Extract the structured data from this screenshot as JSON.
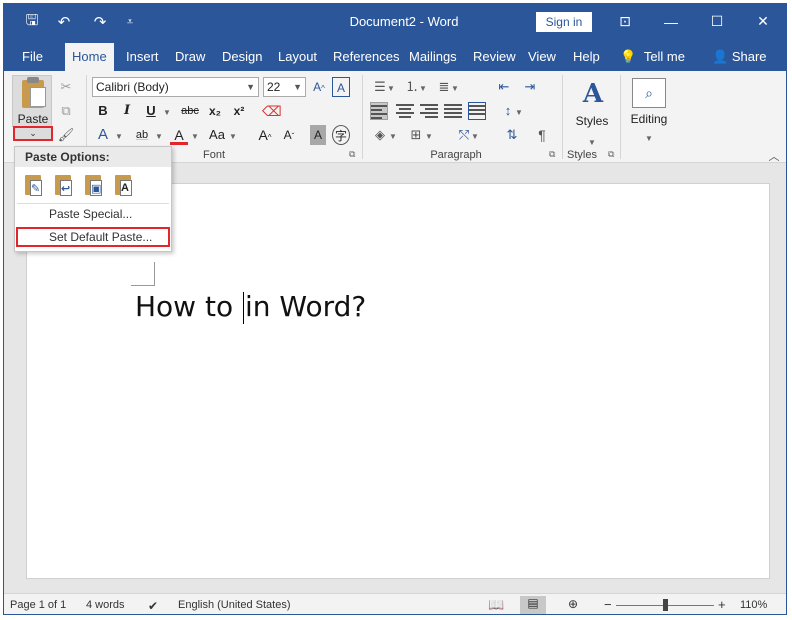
{
  "titlebar": {
    "document_title": "Document2 - Word",
    "sign_in": "Sign in",
    "qat": [
      {
        "name": "save-icon",
        "glyph": "🖫"
      },
      {
        "name": "undo-icon",
        "glyph": "↶"
      },
      {
        "name": "redo-icon",
        "glyph": "↷"
      },
      {
        "name": "customize-qat-icon",
        "glyph": "⩡"
      }
    ],
    "window_controls": [
      {
        "name": "ribbon-display-icon",
        "glyph": "⊡"
      },
      {
        "name": "minimize-icon",
        "glyph": "—"
      },
      {
        "name": "maximize-icon",
        "glyph": "☐"
      },
      {
        "name": "close-icon",
        "glyph": "✕"
      }
    ]
  },
  "tabs": [
    "File",
    "Home",
    "Insert",
    "Draw",
    "Design",
    "Layout",
    "References",
    "Mailings",
    "Review",
    "View",
    "Help"
  ],
  "active_tab": "Home",
  "tell_me": "Tell me",
  "share": "Share",
  "ribbon": {
    "clipboard": {
      "paste_label": "Paste",
      "arrow_glyph": "⌄"
    },
    "font": {
      "font_name": "Calibri (Body)",
      "font_size": "22",
      "group_label": "Font",
      "bold": "B",
      "italic": "I",
      "underline": "U",
      "strike": "abc",
      "subscript": "x₂",
      "superscript": "x²",
      "font_color": "A",
      "change_case": "Aa",
      "grow": "A",
      "shrink": "A",
      "grow_glyph": "^",
      "shrink_glyph": "ˇ",
      "text_effects": "A",
      "highlight_glyph": "ab",
      "clear_glyph": "A",
      "phonetic_glyph": "㊍",
      "char_shade": "A",
      "enclose_glyph": "字"
    },
    "paragraph": {
      "group_label": "Paragraph",
      "show_marks": "¶"
    },
    "styles": {
      "label": "Styles",
      "group_label": "Styles",
      "icon_glyph": "A"
    },
    "editing": {
      "label": "Editing",
      "icon_glyph": "⌕"
    }
  },
  "paste_menu": {
    "header": "Paste Options:",
    "buttons": [
      {
        "name": "paste-keep-source-icon",
        "glyph": "✎"
      },
      {
        "name": "paste-merge-format-icon",
        "glyph": "↩"
      },
      {
        "name": "paste-picture-icon",
        "glyph": "▣"
      },
      {
        "name": "paste-text-only-icon",
        "glyph": "A"
      }
    ],
    "paste_special": "Paste Special...",
    "set_default": "Set Default Paste..."
  },
  "document": {
    "text_before": "How to ",
    "text_after": "in Word?"
  },
  "status": {
    "page": "Page 1 of 1",
    "words": "4 words",
    "language": "English (United States)",
    "zoom": "110%",
    "zoom_minus": "−",
    "zoom_plus": "+"
  },
  "colors": {
    "brand": "#2b579a",
    "highlight_box": "#e3262b",
    "font_color_bar": "#e3262b"
  }
}
